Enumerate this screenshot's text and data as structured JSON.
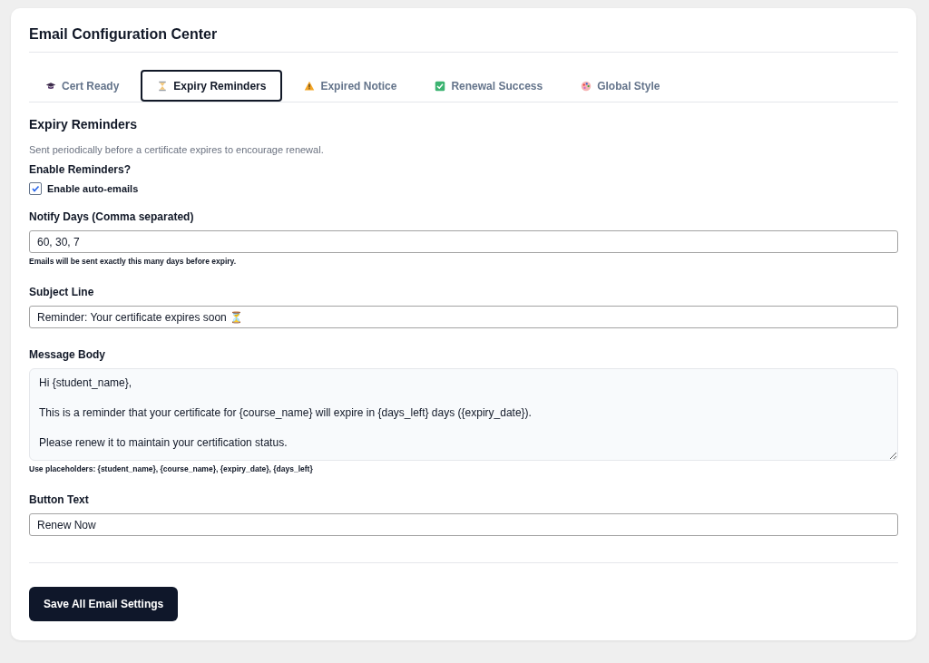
{
  "title": "Email Configuration Center",
  "tabs": [
    {
      "label": "Cert Ready",
      "selected": false
    },
    {
      "label": "Expiry Reminders",
      "selected": true
    },
    {
      "label": "Expired Notice",
      "selected": false
    },
    {
      "label": "Renewal Success",
      "selected": false
    },
    {
      "label": "Global Style",
      "selected": false
    }
  ],
  "section": {
    "heading": "Expiry Reminders",
    "description": "Sent periodically before a certificate expires to encourage renewal."
  },
  "enable": {
    "label": "Enable Reminders?",
    "checkbox_label": "Enable auto-emails",
    "checked": true
  },
  "fields": [
    {
      "kind": "input",
      "label": "Notify Days (Comma separated)",
      "value": "60, 30, 7",
      "help": "Emails will be sent exactly this many days before expiry."
    },
    {
      "kind": "input",
      "label": "Subject Line",
      "value": "Reminder: Your certificate expires soon ⏳"
    },
    {
      "kind": "textarea",
      "label": "Message Body",
      "value": "Hi {student_name},\n\nThis is a reminder that your certificate for {course_name} will expire in {days_left} days ({expiry_date}).\n\nPlease renew it to maintain your certification status.",
      "help": "Use placeholders: {student_name}, {course_name}, {expiry_date}, {days_left}"
    },
    {
      "kind": "input",
      "label": "Button Text",
      "value": "Renew Now"
    }
  ],
  "save_button": "Save All Email Settings"
}
